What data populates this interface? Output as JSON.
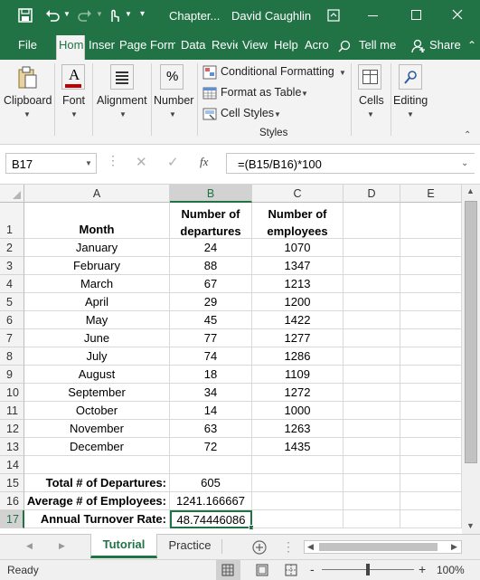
{
  "title_bar": {
    "doc_title": "Chapter...",
    "user_name": "David Caughlin"
  },
  "ribbon_tabs": [
    "File",
    "Hom",
    "Inser",
    "Page",
    "Form",
    "Data",
    "Revie",
    "View",
    "Help",
    "Acro"
  ],
  "active_tab": "Hom",
  "tell_me": "Tell me",
  "share": "Share",
  "ribbon": {
    "clipboard": "Clipboard",
    "font": "Font",
    "alignment": "Alignment",
    "number": "Number",
    "conditional_formatting": "Conditional Formatting",
    "format_as_table": "Format as Table",
    "cell_styles": "Cell Styles",
    "styles_group": "Styles",
    "cells": "Cells",
    "editing": "Editing",
    "percent_symbol": "%",
    "font_icon_letter": "A"
  },
  "formula_bar": {
    "name_box": "B17",
    "fx": "fx",
    "formula": "=(B15/B16)*100"
  },
  "columns": [
    "A",
    "B",
    "C",
    "D",
    "E"
  ],
  "rows": [
    "1",
    "2",
    "3",
    "4",
    "5",
    "6",
    "7",
    "8",
    "9",
    "10",
    "11",
    "12",
    "13",
    "14",
    "15",
    "16",
    "17"
  ],
  "header_row": {
    "a": "Month",
    "b1": "Number of",
    "b2": "departures",
    "c1": "Number of",
    "c2": "employees"
  },
  "data_rows": [
    {
      "month": "January",
      "departures": "24",
      "employees": "1070"
    },
    {
      "month": "February",
      "departures": "88",
      "employees": "1347"
    },
    {
      "month": "March",
      "departures": "67",
      "employees": "1213"
    },
    {
      "month": "April",
      "departures": "29",
      "employees": "1200"
    },
    {
      "month": "May",
      "departures": "45",
      "employees": "1422"
    },
    {
      "month": "June",
      "departures": "77",
      "employees": "1277"
    },
    {
      "month": "July",
      "departures": "74",
      "employees": "1286"
    },
    {
      "month": "August",
      "departures": "18",
      "employees": "1109"
    },
    {
      "month": "September",
      "departures": "34",
      "employees": "1272"
    },
    {
      "month": "October",
      "departures": "14",
      "employees": "1000"
    },
    {
      "month": "November",
      "departures": "63",
      "employees": "1263"
    },
    {
      "month": "December",
      "departures": "72",
      "employees": "1435"
    }
  ],
  "summary": {
    "total_label": "Total # of Departures:",
    "total_value": "605",
    "avg_label": "Average # of Employees:",
    "avg_value": "1241.166667",
    "rate_label": "Annual Turnover Rate:",
    "rate_value": "48.74446086"
  },
  "sheet_tabs": [
    "Tutorial",
    "Practice"
  ],
  "active_sheet": "Tutorial",
  "status": {
    "ready": "Ready",
    "zoom": "100%",
    "minus": "-",
    "plus": "+"
  },
  "colors": {
    "excel_green": "#217346",
    "ribbon_bg": "#f3f3f3"
  }
}
